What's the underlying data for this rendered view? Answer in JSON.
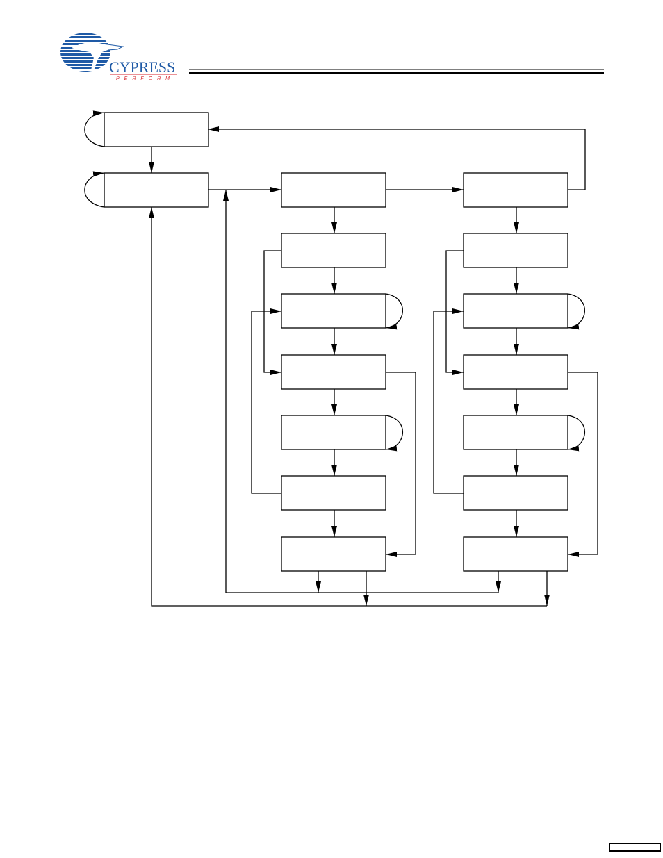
{
  "header": {
    "brand": "CYPRESS",
    "tagline": "PERFORM",
    "brand_color": "#1f5aa6",
    "tagline_color": "#d7262e"
  },
  "diagram": {
    "title": "",
    "boxes": {
      "top_left_1": "",
      "top_left_2": "",
      "col1": [
        "",
        "",
        "",
        "",
        "",
        "",
        ""
      ],
      "col2": [
        "",
        "",
        "",
        "",
        "",
        "",
        ""
      ]
    },
    "self_loops": [
      "top_left_1",
      "top_left_2",
      "col1.2",
      "col1.4",
      "col2.2",
      "col2.4"
    ]
  },
  "footer": {
    "page_box_text": ""
  }
}
